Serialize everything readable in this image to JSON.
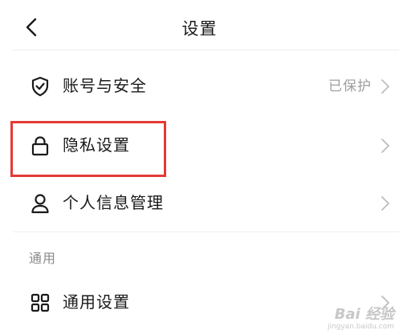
{
  "header": {
    "title": "设置",
    "back_icon": "chevron-left-icon"
  },
  "settings_groups": [
    {
      "items": [
        {
          "icon": "shield-check-icon",
          "label": "账号与安全",
          "value": "已保护"
        },
        {
          "icon": "lock-icon",
          "label": "隐私设置",
          "value": ""
        },
        {
          "icon": "person-icon",
          "label": "个人信息管理",
          "value": ""
        }
      ]
    },
    {
      "section_label": "通用",
      "items": [
        {
          "icon": "grid-icon",
          "label": "通用设置",
          "value": ""
        }
      ]
    }
  ],
  "highlight": {
    "target": "隐私设置",
    "color": "#e53935"
  },
  "watermark": {
    "main": "Bai 经验",
    "sub": "jingyan.baidu.com"
  },
  "colors": {
    "text_primary": "#1a1a1a",
    "text_secondary": "#9e9e9e",
    "divider": "#eeeeee",
    "chevron": "#bdbdbd"
  }
}
